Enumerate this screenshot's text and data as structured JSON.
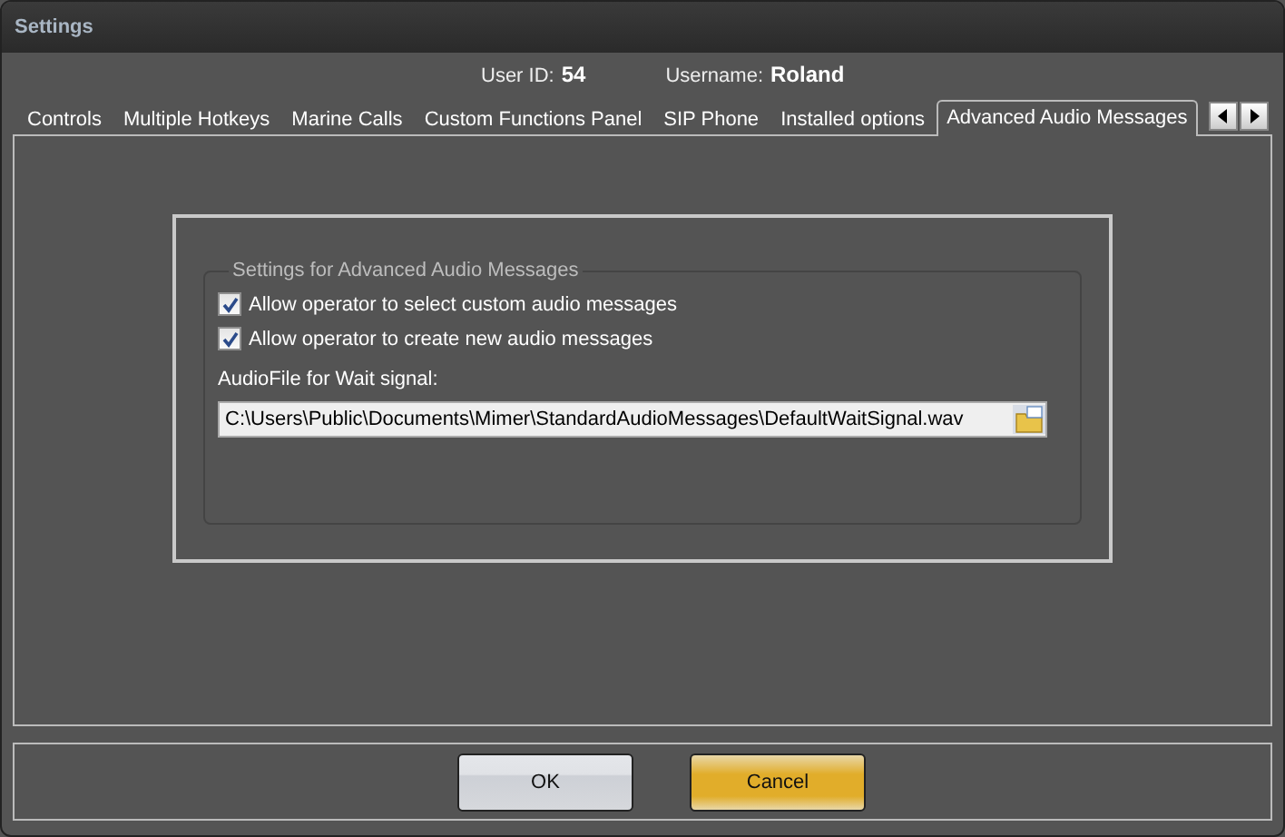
{
  "window": {
    "title": "Settings"
  },
  "user": {
    "id_label": "User ID:",
    "id_value": "54",
    "name_label": "Username:",
    "name_value": "Roland"
  },
  "tabs": [
    {
      "label": "Controls",
      "selected": false
    },
    {
      "label": "Multiple Hotkeys",
      "selected": false
    },
    {
      "label": "Marine Calls",
      "selected": false
    },
    {
      "label": "Custom Functions Panel",
      "selected": false
    },
    {
      "label": "SIP Phone",
      "selected": false
    },
    {
      "label": "Installed options",
      "selected": false
    },
    {
      "label": "Advanced Audio Messages",
      "selected": true
    }
  ],
  "group": {
    "title": "Settings for Advanced Audio Messages",
    "checkboxes": [
      {
        "label": "Allow operator to select custom audio messages",
        "checked": true
      },
      {
        "label": "Allow operator to create new audio messages",
        "checked": true
      }
    ],
    "file_label": "AudioFile for Wait signal:",
    "file_value": "C:\\Users\\Public\\Documents\\Mimer\\StandardAudioMessages\\DefaultWaitSignal.wav"
  },
  "buttons": [
    {
      "label": "OK",
      "kind": "default"
    },
    {
      "label": "Cancel",
      "kind": "primary"
    }
  ]
}
